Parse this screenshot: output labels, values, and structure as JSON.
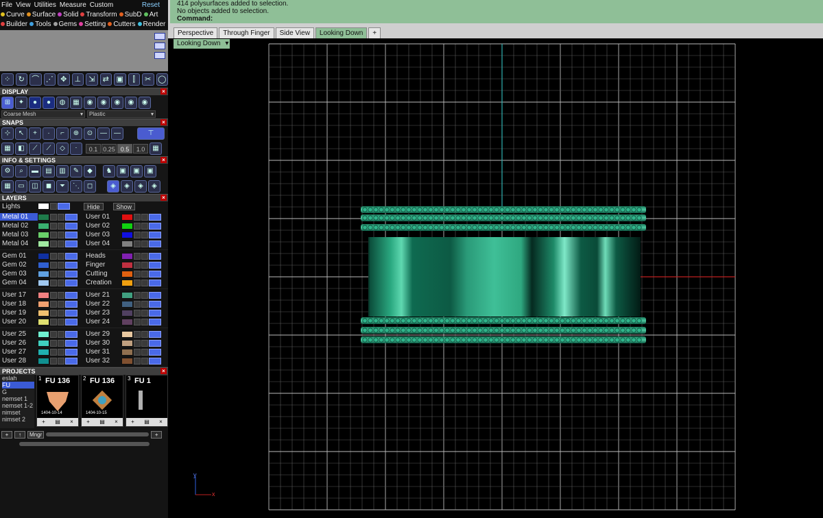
{
  "menu": {
    "items": [
      "File",
      "View",
      "Utilities",
      "Measure",
      "Custom"
    ],
    "reset": "Reset"
  },
  "categories_row1": [
    {
      "label": "Curve",
      "color": "#e0c020"
    },
    {
      "label": "Surface",
      "color": "#e09020"
    },
    {
      "label": "Solid",
      "color": "#c040c0"
    },
    {
      "label": "Transform",
      "color": "#e04040"
    },
    {
      "label": "SubD",
      "color": "#e06020"
    },
    {
      "label": "Art",
      "color": "#60c060"
    }
  ],
  "categories_row2": [
    {
      "label": "Builder",
      "color": "#e04040"
    },
    {
      "label": "Tools",
      "color": "#40a0e0"
    },
    {
      "label": "Gems",
      "color": "#a0a0a0"
    },
    {
      "label": "Setting",
      "color": "#e040a0"
    },
    {
      "label": "Cutters",
      "color": "#e06020"
    },
    {
      "label": "Render",
      "color": "#40c0e0"
    }
  ],
  "sections": {
    "display": "DISPLAY",
    "snaps": "SNAPS",
    "info": "INFO & SETTINGS",
    "layers": "LAYERS",
    "projects": "PROJECTS"
  },
  "display": {
    "mesh_select": "Coarse Mesh",
    "material_select": "Plastic"
  },
  "snaps": {
    "values": [
      "0.1",
      "0.25",
      "0.5",
      "1.0"
    ],
    "selected": "0.5"
  },
  "layers": {
    "lights": "Lights",
    "hide": "Hide",
    "show": "Show",
    "groups": [
      {
        "left": [
          {
            "name": "Metal 01",
            "color": "#1e7a4a",
            "selected": true
          },
          {
            "name": "Metal 02",
            "color": "#3ab070"
          },
          {
            "name": "Metal 03",
            "color": "#6ad06a"
          },
          {
            "name": "Metal 04",
            "color": "#a0e8a0"
          }
        ],
        "right": [
          {
            "name": "User 01",
            "color": "#e01010"
          },
          {
            "name": "User 02",
            "color": "#10d010"
          },
          {
            "name": "User 03",
            "color": "#1010e0"
          },
          {
            "name": "User 04",
            "color": "#808080"
          }
        ]
      },
      {
        "left": [
          {
            "name": "Gem 01",
            "color": "#1030a0"
          },
          {
            "name": "Gem 02",
            "color": "#3060d0"
          },
          {
            "name": "Gem 03",
            "color": "#60a0e0"
          },
          {
            "name": "Gem 04",
            "color": "#a0c8f0"
          }
        ],
        "right": [
          {
            "name": "Heads",
            "color": "#8020b0"
          },
          {
            "name": "Finger",
            "color": "#c03040"
          },
          {
            "name": "Cutting",
            "color": "#e06010"
          },
          {
            "name": "Creation",
            "color": "#f0a010"
          }
        ]
      },
      {
        "left": [
          {
            "name": "User 17",
            "color": "#f08080"
          },
          {
            "name": "User 18",
            "color": "#f0a070"
          },
          {
            "name": "User 19",
            "color": "#f0c070"
          },
          {
            "name": "User 20",
            "color": "#e0e070"
          }
        ],
        "right": [
          {
            "name": "User 21",
            "color": "#40a080"
          },
          {
            "name": "User 22",
            "color": "#406080"
          },
          {
            "name": "User 23",
            "color": "#504060"
          },
          {
            "name": "User 24",
            "color": "#604060"
          }
        ]
      },
      {
        "left": [
          {
            "name": "User 25",
            "color": "#70f0d0"
          },
          {
            "name": "User 26",
            "color": "#40d0c0"
          },
          {
            "name": "User 27",
            "color": "#20b0b0"
          },
          {
            "name": "User 28",
            "color": "#109090"
          }
        ],
        "right": [
          {
            "name": "User 29",
            "color": "#e8c8a0"
          },
          {
            "name": "User 30",
            "color": "#c0a080"
          },
          {
            "name": "User 31",
            "color": "#907050"
          },
          {
            "name": "User 32",
            "color": "#805030"
          }
        ]
      }
    ]
  },
  "projects": {
    "list": [
      "eslah",
      "FU",
      "G",
      "nemset 1",
      "nemset 1-2",
      "nimset",
      "nimset 2"
    ],
    "selected": "FU",
    "thumbs": [
      {
        "num": "1",
        "title": "FU 136",
        "label": "1404-10-14"
      },
      {
        "num": "2",
        "title": "FU 136",
        "label": "1404-10-15"
      },
      {
        "num": "3",
        "title": "FU 1"
      }
    ],
    "manager": "Mngr"
  },
  "console": {
    "line1": "414 polysurfaces added to selection.",
    "line2": "No objects added to selection.",
    "command": "Command:"
  },
  "tabs": [
    "Perspective",
    "Through Finger",
    "Side View",
    "Looking Down",
    "+"
  ],
  "active_tab": "Looking Down",
  "view_select": "Looking Down",
  "axis_labels": {
    "x": "x",
    "y": "y"
  }
}
